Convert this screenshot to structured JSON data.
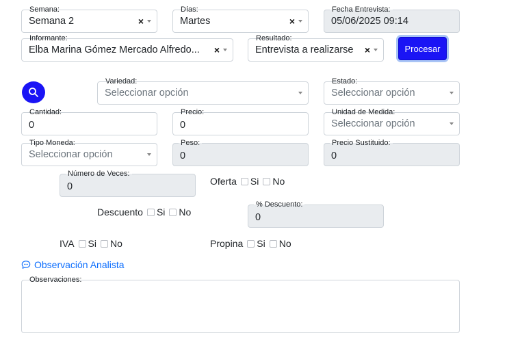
{
  "semana": {
    "label": "Semana:",
    "value": "Semana 2"
  },
  "dias": {
    "label": "Días:",
    "value": "Martes"
  },
  "fecha_entrevista": {
    "label": "Fecha Entrevista:",
    "value": "05/06/2025 09:14"
  },
  "informante": {
    "label": "Informante:",
    "value": "Elba Marina Gómez Mercado Alfredo..."
  },
  "resultado": {
    "label": "Resultado:",
    "value": "Entrevista a realizarse"
  },
  "procesar_label": "Procesar",
  "variedad": {
    "label": "Variedad:",
    "placeholder": "Seleccionar opción"
  },
  "estado": {
    "label": "Estado:",
    "placeholder": "Seleccionar opción"
  },
  "cantidad": {
    "label": "Cantidad:",
    "value": "0"
  },
  "precio": {
    "label": "Precio:",
    "value": "0"
  },
  "unidad_medida": {
    "label": "Unidad de Medida:",
    "placeholder": "Seleccionar opción"
  },
  "tipo_moneda": {
    "label": "Tipo Moneda:",
    "placeholder": "Seleccionar opción"
  },
  "peso": {
    "label": "Peso:",
    "value": "0"
  },
  "precio_sustituido": {
    "label": "Precio Sustituido:",
    "value": "0"
  },
  "numero_veces": {
    "label": "Número de Veces:",
    "value": "0"
  },
  "porc_descuento": {
    "label": "% Descuento:",
    "value": "0"
  },
  "oferta": {
    "label": "Oferta",
    "si": "Si",
    "no": "No"
  },
  "descuento": {
    "label": "Descuento",
    "si": "Si",
    "no": "No"
  },
  "iva": {
    "label": "IVA",
    "si": "Si",
    "no": "No"
  },
  "propina": {
    "label": "Propina",
    "si": "Si",
    "no": "No"
  },
  "observacion_analista": "Observación Analista",
  "observaciones": {
    "label": "Observaciones:",
    "value": ""
  },
  "icons": {
    "search": "search-icon",
    "chat": "chat-icon",
    "clear": "clear-x-icon",
    "caret": "caret-down-icon"
  },
  "colors": {
    "primary": "#1a14f5",
    "link": "#0d6efd",
    "disabled_bg": "#e9ecef",
    "border": "#ced4da"
  }
}
